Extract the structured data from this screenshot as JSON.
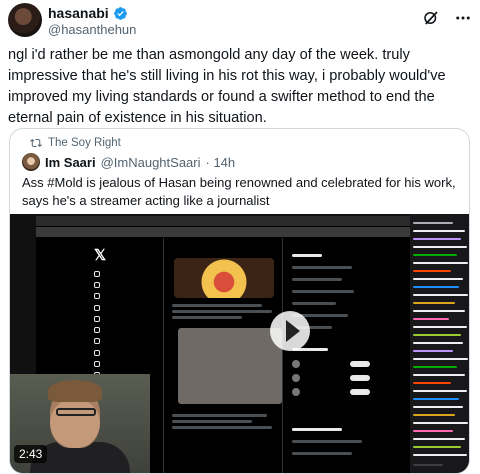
{
  "tweet": {
    "display_name": "hasanabi",
    "handle": "@hasanthehun",
    "text": "ngl i'd rather be me than asmongold any day of the week. truly impressive that he's still living in his rot this way, i probably would've improved my living standards or found a swifter method to end the eternal pain of existence in his situation."
  },
  "quote": {
    "social_context": "The Soy Right",
    "author_name": "Im Saari",
    "author_handle": "@ImNaughtSaari",
    "time": "· 14h",
    "text": "Ass #Mold is jealous of Hasan being renowned and celebrated for his work, says he's a streamer acting like a journalist",
    "video_time": "2:43"
  },
  "colors": {
    "verified": "#1d9bf0",
    "text": "#0f1419",
    "secondary": "#536471",
    "border": "#cfd9de"
  },
  "icons": [
    "verified-badge-icon",
    "grok-icon",
    "more-options-icon",
    "repost-icon",
    "play-icon"
  ]
}
